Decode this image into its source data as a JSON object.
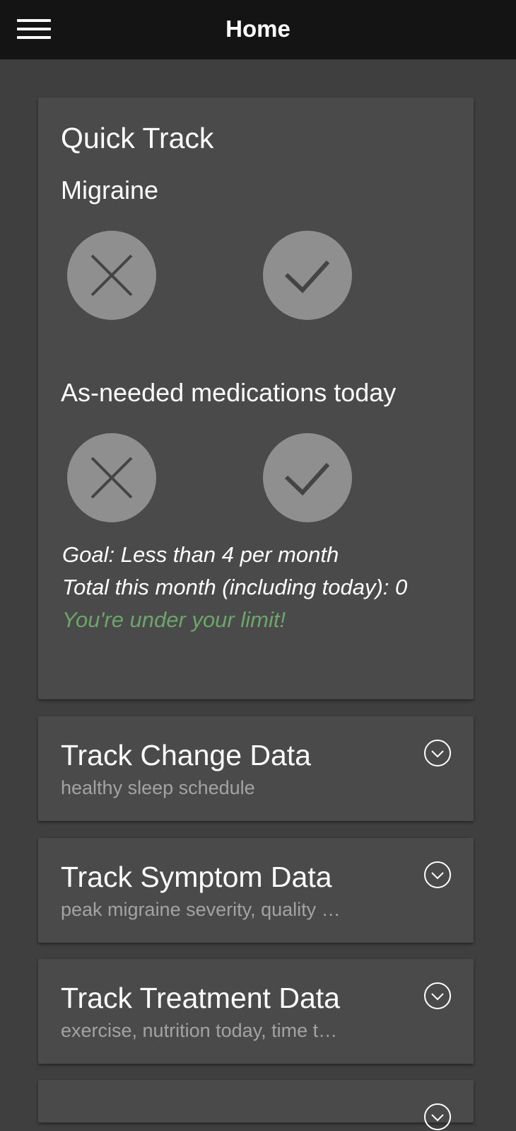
{
  "header": {
    "title": "Home",
    "menu_icon": "hamburger-icon"
  },
  "quick_track": {
    "title": "Quick Track",
    "migraine_label": "Migraine",
    "medications_label": "As-needed medications today",
    "no_icon": "close-icon",
    "yes_icon": "check-icon",
    "goal_text": "Goal: Less than 4 per month",
    "total_text": "Total this month (including today): 0",
    "status_text": "You're under your limit!",
    "status_color": "#6da56b"
  },
  "track_sections": [
    {
      "title": "Track Change Data",
      "subtitle": "healthy sleep schedule"
    },
    {
      "title": "Track Symptom Data",
      "subtitle": "peak migraine severity, quality …"
    },
    {
      "title": "Track Treatment Data",
      "subtitle": "exercise, nutrition today, time t…"
    }
  ],
  "colors": {
    "background": "#3f3f3f",
    "card": "#4a4a4a",
    "header": "#141414",
    "button": "#8f8f8f"
  }
}
